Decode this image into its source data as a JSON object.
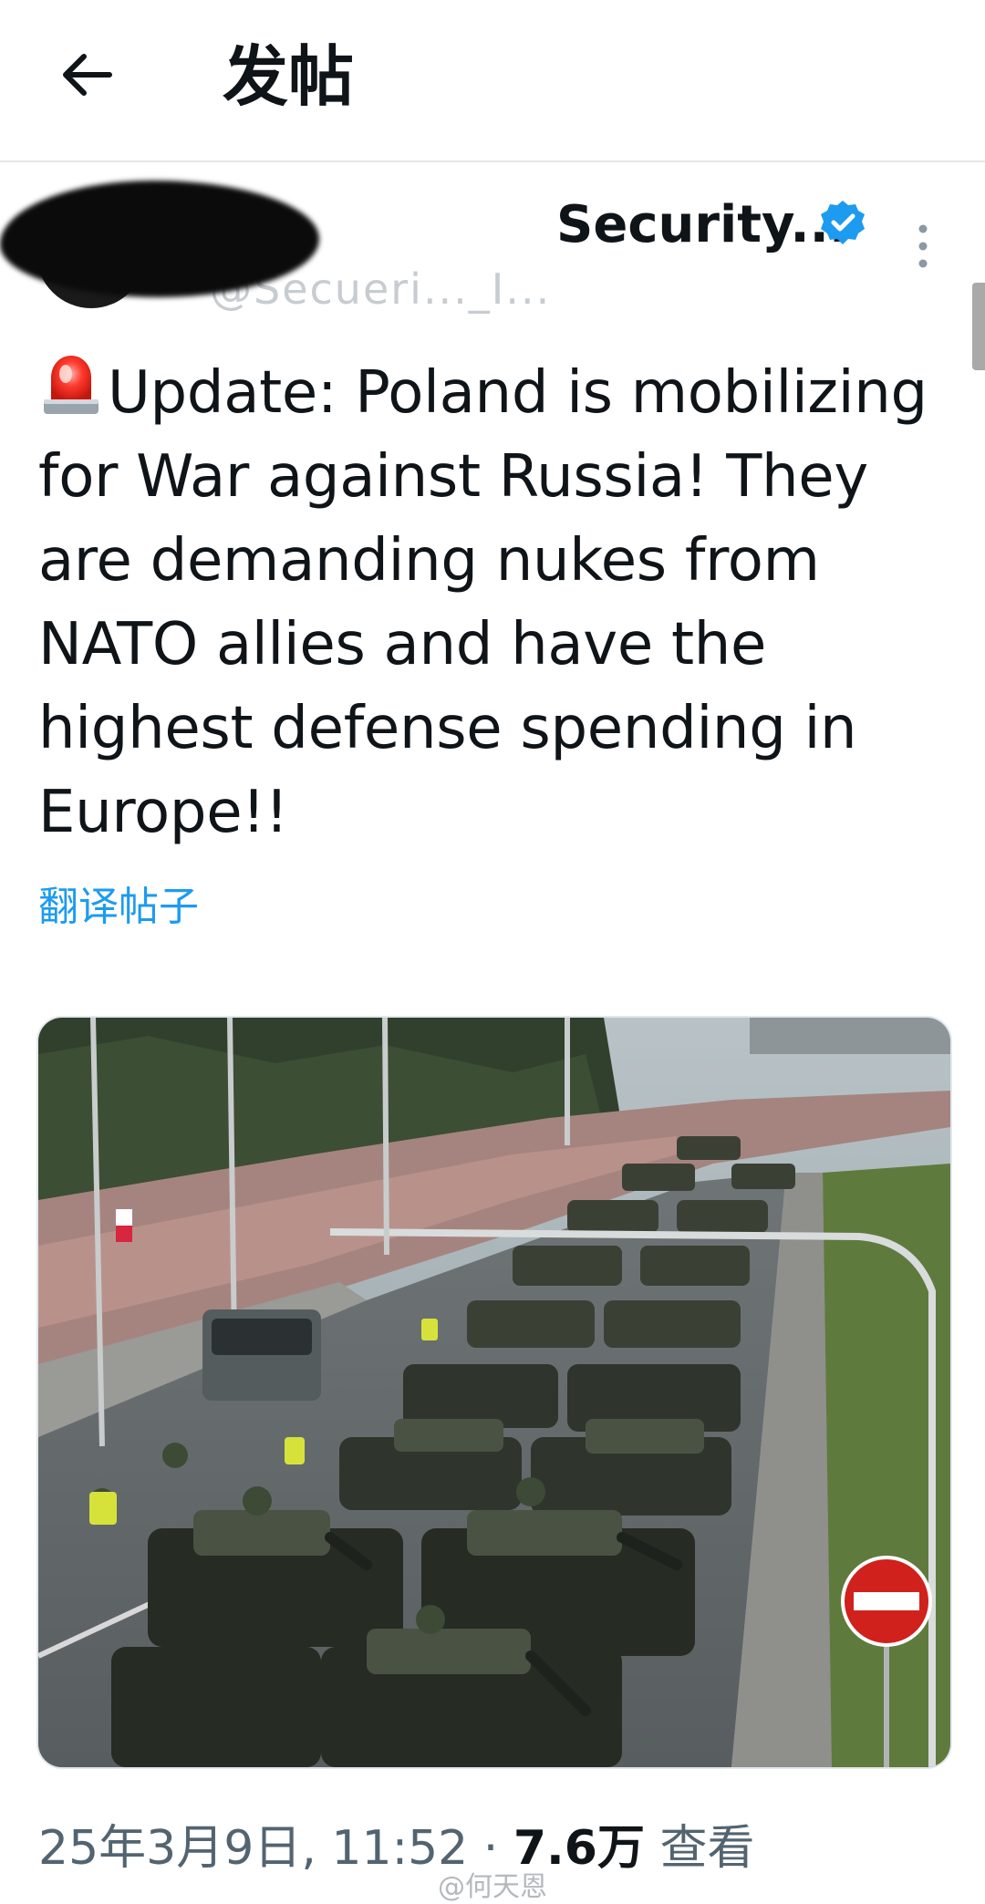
{
  "header": {
    "title": "发帖",
    "back_icon": "arrow-left-icon"
  },
  "author": {
    "display_name": "Security...",
    "handle": "@Secueri..._I...",
    "verified": true,
    "badge_color": "#1d9bf0",
    "more_icon": "more-vertical-icon"
  },
  "post": {
    "emoji": "siren-icon",
    "text": "Update: Poland is mobilizing for War against Russia! They are demanding nukes from NATO allies and have the highest defense spending in Europe!!",
    "translate_label": "翻译帖子"
  },
  "media": {
    "image_description": "photo"
  },
  "meta": {
    "datetime": "25年3月9日, 11:52 · ",
    "views_count": "7.6万",
    "views_label": " 查看"
  },
  "watermark": "@何天恩",
  "colors": {
    "accent": "#1d9bf0",
    "text": "#0f1419",
    "muted": "#536471"
  }
}
